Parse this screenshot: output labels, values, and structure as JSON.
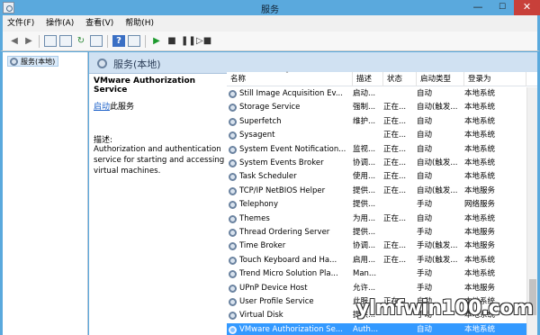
{
  "window": {
    "title": "服务",
    "minimize": "—",
    "maximize": "☐",
    "close": "✕"
  },
  "menu": [
    "文件(F)",
    "操作(A)",
    "查看(V)",
    "帮助(H)"
  ],
  "toolbar": {
    "icons": [
      "back-arrow-icon",
      "forward-arrow-icon",
      "console-tree-icon",
      "properties-icon",
      "refresh-icon",
      "export-icon",
      "help-icon",
      "view-icon",
      "start-service-icon",
      "stop-service-icon",
      "pause-service-icon",
      "restart-service-icon"
    ]
  },
  "tree": {
    "item": "服务(本地)"
  },
  "header": {
    "title": "服务(本地)"
  },
  "details": {
    "service_name": "VMware Authorization Service",
    "start_link": "启动",
    "start_suffix": "此服务",
    "desc_label": "描述:",
    "desc_text": "Authorization and authentication service for starting and accessing virtual machines."
  },
  "columns": {
    "name": "名称",
    "desc": "描述",
    "status": "状态",
    "start": "启动类型",
    "logon": "登录为"
  },
  "rows": [
    {
      "name": "Still Image Acquisition Ev...",
      "desc": "启动...",
      "status": "",
      "start": "自动",
      "logon": "本地系统"
    },
    {
      "name": "Storage Service",
      "desc": "强制...",
      "status": "正在...",
      "start": "自动(触发...",
      "logon": "本地系统"
    },
    {
      "name": "Superfetch",
      "desc": "维护...",
      "status": "正在...",
      "start": "自动",
      "logon": "本地系统"
    },
    {
      "name": "Sysagent",
      "desc": "",
      "status": "正在...",
      "start": "自动",
      "logon": "本地系统"
    },
    {
      "name": "System Event Notification...",
      "desc": "监视...",
      "status": "正在...",
      "start": "自动",
      "logon": "本地系统"
    },
    {
      "name": "System Events Broker",
      "desc": "协调...",
      "status": "正在...",
      "start": "自动(触发...",
      "logon": "本地系统"
    },
    {
      "name": "Task Scheduler",
      "desc": "使用...",
      "status": "正在...",
      "start": "自动",
      "logon": "本地系统"
    },
    {
      "name": "TCP/IP NetBIOS Helper",
      "desc": "提供...",
      "status": "正在...",
      "start": "自动(触发...",
      "logon": "本地服务"
    },
    {
      "name": "Telephony",
      "desc": "提供...",
      "status": "",
      "start": "手动",
      "logon": "网络服务"
    },
    {
      "name": "Themes",
      "desc": "为用...",
      "status": "正在...",
      "start": "自动",
      "logon": "本地系统"
    },
    {
      "name": "Thread Ordering Server",
      "desc": "提供...",
      "status": "",
      "start": "手动",
      "logon": "本地服务"
    },
    {
      "name": "Time Broker",
      "desc": "协调...",
      "status": "正在...",
      "start": "手动(触发...",
      "logon": "本地服务"
    },
    {
      "name": "Touch Keyboard and Ha...",
      "desc": "启用...",
      "status": "正在...",
      "start": "手动(触发...",
      "logon": "本地系统"
    },
    {
      "name": "Trend Micro Solution Pla...",
      "desc": "Man...",
      "status": "",
      "start": "手动",
      "logon": "本地系统"
    },
    {
      "name": "UPnP Device Host",
      "desc": "允许...",
      "status": "",
      "start": "手动",
      "logon": "本地服务"
    },
    {
      "name": "User Profile Service",
      "desc": "此服...",
      "status": "正在...",
      "start": "自动",
      "logon": "本地系统"
    },
    {
      "name": "Virtual Disk",
      "desc": "提供...",
      "status": "",
      "start": "手动",
      "logon": "本地系统"
    },
    {
      "name": "VMware Authorization Se...",
      "desc": "Auth...",
      "status": "",
      "start": "自动",
      "logon": "本地系统",
      "selected": true
    }
  ],
  "watermark": "ylmfwin100.com"
}
